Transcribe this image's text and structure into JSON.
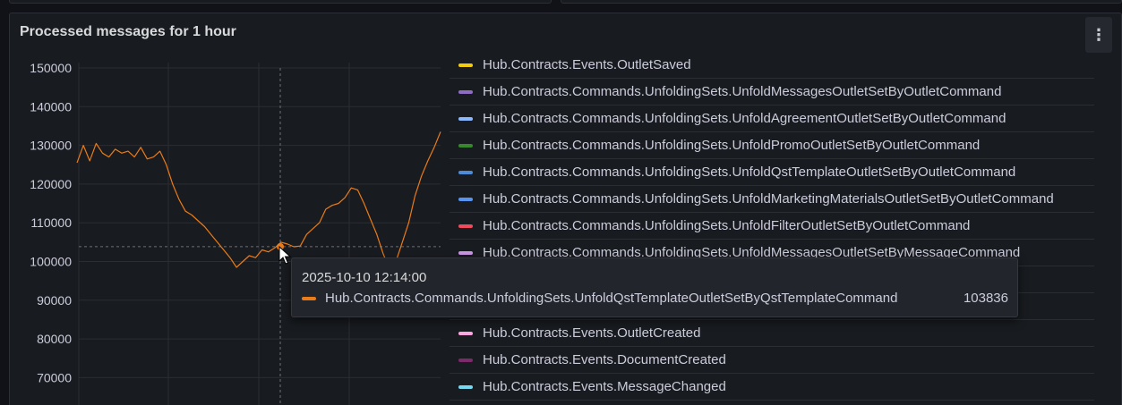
{
  "panel": {
    "title": "Processed messages for 1 hour",
    "menu_icon": "kebab-vertical-icon",
    "menu_glyph": "⋮"
  },
  "chart_data": {
    "type": "line",
    "title": "Processed messages for 1 hour",
    "ylabel": "",
    "xlabel": "",
    "ylim": [
      64000,
      152000
    ],
    "y_ticks": [
      "150000",
      "140000",
      "130000",
      "120000",
      "110000",
      "100000",
      "90000",
      "80000",
      "70000"
    ],
    "grid": true,
    "legend_position": "right",
    "series": [
      {
        "name": "Hub.Contracts.Commands.UnfoldingSets.UnfoldQstTemplateOutletSetByQstTemplateCommand",
        "color": "#eb7b18",
        "values": [
          125500,
          130000,
          126000,
          130500,
          128000,
          127000,
          129000,
          128000,
          128500,
          127000,
          129500,
          126500,
          127000,
          128500,
          125000,
          120000,
          116000,
          113000,
          112000,
          110500,
          109000,
          107000,
          105000,
          103000,
          101000,
          98500,
          100000,
          101500,
          101000,
          103000,
          102500,
          103500,
          105000,
          104500,
          103800,
          104000,
          107000,
          108500,
          110000,
          113500,
          114500,
          115000,
          116500,
          119000,
          118500,
          115000,
          111000,
          107000,
          102000,
          98000,
          100000,
          105000,
          110000,
          117000,
          122000,
          126000,
          129500,
          133500
        ]
      }
    ],
    "crosshair": {
      "time": "2025-10-10 12:14:00",
      "value": 103836
    }
  },
  "legend": [
    {
      "label": "Hub.Contracts.Events.OutletSaved",
      "color": "#f2cc0c"
    },
    {
      "label": "Hub.Contracts.Commands.UnfoldingSets.UnfoldMessagesOutletSetByOutletCommand",
      "color": "#8f6cc4"
    },
    {
      "label": "Hub.Contracts.Commands.UnfoldingSets.UnfoldAgreementOutletSetByOutletCommand",
      "color": "#8ab8ff"
    },
    {
      "label": "Hub.Contracts.Commands.UnfoldingSets.UnfoldPromoOutletSetByOutletCommand",
      "color": "#37872d"
    },
    {
      "label": "Hub.Contracts.Commands.UnfoldingSets.UnfoldQstTemplateOutletSetByOutletCommand",
      "color": "#4d8bd6"
    },
    {
      "label": "Hub.Contracts.Commands.UnfoldingSets.UnfoldMarketingMaterialsOutletSetByOutletCommand",
      "color": "#5794f2"
    },
    {
      "label": "Hub.Contracts.Commands.UnfoldingSets.UnfoldFilterOutletSetByOutletCommand",
      "color": "#f2495c"
    },
    {
      "label": "Hub.Contracts.Commands.UnfoldingSets.UnfoldMessagesOutletSetByMessageCommand",
      "color": "#ca95e5"
    },
    {
      "label": "",
      "color": "#22252b"
    },
    {
      "label": "",
      "color": "#22252b"
    },
    {
      "label": "Hub.Contracts.Events.OutletCreated",
      "color": "#ffa6e0"
    },
    {
      "label": "Hub.Contracts.Events.DocumentCreated",
      "color": "#7c2a6a"
    },
    {
      "label": "Hub.Contracts.Events.MessageChanged",
      "color": "#73d8f0"
    }
  ],
  "tooltip": {
    "time": "2025-10-10 12:14:00",
    "series_name": "Hub.Contracts.Commands.UnfoldingSets.UnfoldQstTemplateOutletSetByQstTemplateCommand",
    "value": "103836",
    "color": "#eb7b18"
  },
  "cursor_icon": "mouse-pointer-icon"
}
